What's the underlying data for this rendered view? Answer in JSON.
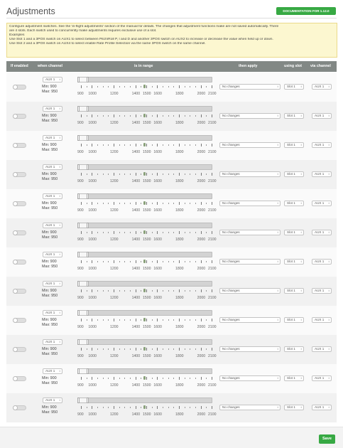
{
  "page": {
    "title": "Adjustments",
    "doc_button": "DOCUMENTATION FOR 1.12.0"
  },
  "note": {
    "lines": [
      "Configure adjustment switches. See the 'in-flight adjustments' section of the manual for details. The changes that adjustment functions make are not saved automatically. There",
      "are 4 slots. Each switch used to concurrently make adjustments requires exclusive use of a slot.",
      "Examples",
      "Use Slot 1 and a 3POS switch on AUX1 to select between Pitch/Roll P, I and D and another 3POS switch on AUX2 to increase or decrease the value when held up or down.",
      "Use Slot 2 and a 3POS switch on AUX4 to select enable Rate Profile Selection via the same 3POS switch on the same channel."
    ]
  },
  "header": {
    "if_enabled": "If enabled",
    "when_channel": "when channel",
    "is_in_range": "is in range",
    "then_apply": "then apply",
    "using_slot": "using slot",
    "via_channel": "via channel"
  },
  "tick_labels": [
    "900",
    "1000",
    "1200",
    "1400",
    "1500",
    "1600",
    "1800",
    "2000",
    "2100"
  ],
  "rows": [
    {
      "channel": "AUX 1",
      "min": "Min: 900",
      "max": "Max: 950",
      "apply": "No changes",
      "slot": "Slot 1",
      "via": "AUX 1"
    },
    {
      "channel": "AUX 1",
      "min": "Min: 900",
      "max": "Max: 950",
      "apply": "No changes",
      "slot": "Slot 1",
      "via": "AUX 1"
    },
    {
      "channel": "AUX 1",
      "min": "Min: 900",
      "max": "Max: 950",
      "apply": "No changes",
      "slot": "Slot 1",
      "via": "AUX 1"
    },
    {
      "channel": "AUX 1",
      "min": "Min: 900",
      "max": "Max: 950",
      "apply": "No changes",
      "slot": "Slot 1",
      "via": "AUX 1"
    },
    {
      "channel": "AUX 1",
      "min": "Min: 900",
      "max": "Max: 950",
      "apply": "No changes",
      "slot": "Slot 1",
      "via": "AUX 1"
    },
    {
      "channel": "AUX 1",
      "min": "Min: 900",
      "max": "Max: 950",
      "apply": "No changes",
      "slot": "Slot 1",
      "via": "AUX 1"
    },
    {
      "channel": "AUX 1",
      "min": "Min: 900",
      "max": "Max: 950",
      "apply": "No changes",
      "slot": "Slot 1",
      "via": "AUX 1"
    },
    {
      "channel": "AUX 1",
      "min": "Min: 900",
      "max": "Max: 950",
      "apply": "No changes",
      "slot": "Slot 1",
      "via": "AUX 1"
    },
    {
      "channel": "AUX 1",
      "min": "Min: 900",
      "max": "Max: 950",
      "apply": "No changes",
      "slot": "Slot 1",
      "via": "AUX 1"
    },
    {
      "channel": "AUX 1",
      "min": "Min: 900",
      "max": "Max: 950",
      "apply": "No changes",
      "slot": "Slot 1",
      "via": "AUX 1"
    },
    {
      "channel": "AUX 1",
      "min": "Min: 900",
      "max": "Max: 950",
      "apply": "No changes",
      "slot": "Slot 1",
      "via": "AUX 1"
    },
    {
      "channel": "AUX 1",
      "min": "Min: 900",
      "max": "Max: 950",
      "apply": "No changes",
      "slot": "Slot 1",
      "via": "AUX 1"
    }
  ],
  "footer": {
    "save": "Save"
  },
  "colors": {
    "accent_green": "#37a943",
    "header_gray": "#828885",
    "note_yellow": "#fcf7d0",
    "marker_green": "#8aa17b"
  },
  "icons": {
    "select_arrow": "updown-arrows-icon"
  }
}
